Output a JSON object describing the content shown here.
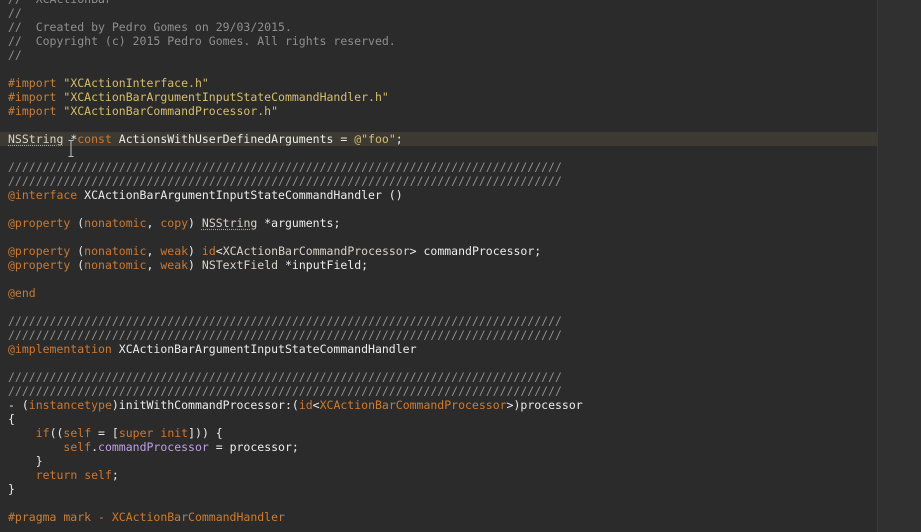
{
  "editor": {
    "language": "objective-c",
    "lines": [
      {
        "tokens": [
          {
            "t": "//  XCActionBar",
            "c": "comment"
          }
        ]
      },
      {
        "tokens": [
          {
            "t": "//",
            "c": "comment"
          }
        ]
      },
      {
        "tokens": [
          {
            "t": "//  Created by Pedro Gomes on 29/03/2015.",
            "c": "comment"
          }
        ]
      },
      {
        "tokens": [
          {
            "t": "//  Copyright (c) 2015 Pedro Gomes. All rights reserved.",
            "c": "comment"
          }
        ]
      },
      {
        "tokens": [
          {
            "t": "//",
            "c": "comment"
          }
        ]
      },
      {
        "tokens": []
      },
      {
        "tokens": [
          {
            "t": "#import ",
            "c": "preproc"
          },
          {
            "t": "\"XCActionInterface.h\"",
            "c": "string"
          }
        ]
      },
      {
        "tokens": [
          {
            "t": "#import ",
            "c": "preproc"
          },
          {
            "t": "\"XCActionBarArgumentInputStateCommandHandler.h\"",
            "c": "string"
          }
        ]
      },
      {
        "tokens": [
          {
            "t": "#import ",
            "c": "preproc"
          },
          {
            "t": "\"XCActionBarCommandProcessor.h\"",
            "c": "string"
          }
        ]
      },
      {
        "tokens": []
      },
      {
        "current": true,
        "tokens": [
          {
            "t": "NSString",
            "c": "class",
            "u": true
          },
          {
            "t": " *",
            "c": "plain"
          },
          {
            "t": "const",
            "c": "keyword"
          },
          {
            "t": " ActionsWithUserDefinedArguments = ",
            "c": "plain"
          },
          {
            "t": "@\"foo\"",
            "c": "string"
          },
          {
            "t": ";",
            "c": "plain"
          }
        ]
      },
      {
        "tokens": []
      },
      {
        "tokens": [
          {
            "t": "////////////////////////////////////////////////////////////////////////////////",
            "c": "comment"
          }
        ]
      },
      {
        "tokens": [
          {
            "t": "////////////////////////////////////////////////////////////////////////////////",
            "c": "comment"
          }
        ]
      },
      {
        "tokens": [
          {
            "t": "@interface",
            "c": "keyword"
          },
          {
            "t": " XCActionBarArgumentInputStateCommandHandler ()",
            "c": "plain"
          }
        ]
      },
      {
        "tokens": []
      },
      {
        "tokens": [
          {
            "t": "@property",
            "c": "keyword"
          },
          {
            "t": " (",
            "c": "plain"
          },
          {
            "t": "nonatomic",
            "c": "keyword"
          },
          {
            "t": ", ",
            "c": "plain"
          },
          {
            "t": "copy",
            "c": "keyword"
          },
          {
            "t": ") ",
            "c": "plain"
          },
          {
            "t": "NSString",
            "c": "class",
            "u": true
          },
          {
            "t": " *arguments;",
            "c": "plain"
          }
        ]
      },
      {
        "tokens": []
      },
      {
        "tokens": [
          {
            "t": "@property",
            "c": "keyword"
          },
          {
            "t": " (",
            "c": "plain"
          },
          {
            "t": "nonatomic",
            "c": "keyword"
          },
          {
            "t": ", ",
            "c": "plain"
          },
          {
            "t": "weak",
            "c": "keyword"
          },
          {
            "t": ") ",
            "c": "plain"
          },
          {
            "t": "id",
            "c": "keyword"
          },
          {
            "t": "<",
            "c": "plain"
          },
          {
            "t": "XCActionBarCommandProcessor",
            "c": "class"
          },
          {
            "t": "> commandProcessor;",
            "c": "plain"
          }
        ]
      },
      {
        "tokens": [
          {
            "t": "@property",
            "c": "keyword"
          },
          {
            "t": " (",
            "c": "plain"
          },
          {
            "t": "nonatomic",
            "c": "keyword"
          },
          {
            "t": ", ",
            "c": "plain"
          },
          {
            "t": "weak",
            "c": "keyword"
          },
          {
            "t": ") ",
            "c": "plain"
          },
          {
            "t": "NSTextField",
            "c": "class"
          },
          {
            "t": " *inputField;",
            "c": "plain"
          }
        ]
      },
      {
        "tokens": []
      },
      {
        "tokens": [
          {
            "t": "@end",
            "c": "keyword"
          }
        ]
      },
      {
        "tokens": []
      },
      {
        "tokens": [
          {
            "t": "////////////////////////////////////////////////////////////////////////////////",
            "c": "comment"
          }
        ]
      },
      {
        "tokens": [
          {
            "t": "////////////////////////////////////////////////////////////////////////////////",
            "c": "comment"
          }
        ]
      },
      {
        "tokens": [
          {
            "t": "@implementation",
            "c": "keyword"
          },
          {
            "t": " XCActionBarArgumentInputStateCommandHandler",
            "c": "plain"
          }
        ]
      },
      {
        "tokens": []
      },
      {
        "tokens": [
          {
            "t": "////////////////////////////////////////////////////////////////////////////////",
            "c": "comment"
          }
        ]
      },
      {
        "tokens": [
          {
            "t": "////////////////////////////////////////////////////////////////////////////////",
            "c": "comment"
          }
        ]
      },
      {
        "tokens": [
          {
            "t": "- (",
            "c": "plain"
          },
          {
            "t": "instancetype",
            "c": "keyword"
          },
          {
            "t": ")initWithCommandProcessor:(",
            "c": "plain"
          },
          {
            "t": "id",
            "c": "keyword"
          },
          {
            "t": "<",
            "c": "plain"
          },
          {
            "t": "XCActionBarCommandProcessor",
            "c": "param"
          },
          {
            "t": ">)processor",
            "c": "plain"
          }
        ]
      },
      {
        "tokens": [
          {
            "t": "{",
            "c": "plain"
          }
        ]
      },
      {
        "tokens": [
          {
            "t": "    ",
            "c": "plain"
          },
          {
            "t": "if",
            "c": "keyword"
          },
          {
            "t": "((",
            "c": "plain"
          },
          {
            "t": "self",
            "c": "keyword"
          },
          {
            "t": " = [",
            "c": "plain"
          },
          {
            "t": "super",
            "c": "keyword"
          },
          {
            "t": " ",
            "c": "plain"
          },
          {
            "t": "init",
            "c": "keyword"
          },
          {
            "t": "])) {",
            "c": "plain"
          }
        ]
      },
      {
        "tokens": [
          {
            "t": "        ",
            "c": "plain"
          },
          {
            "t": "self",
            "c": "keyword"
          },
          {
            "t": ".",
            "c": "plain"
          },
          {
            "t": "commandProcessor",
            "c": "property"
          },
          {
            "t": " = processor;",
            "c": "plain"
          }
        ]
      },
      {
        "tokens": [
          {
            "t": "    }",
            "c": "plain"
          }
        ]
      },
      {
        "tokens": [
          {
            "t": "    ",
            "c": "plain"
          },
          {
            "t": "return",
            "c": "keyword"
          },
          {
            "t": " ",
            "c": "plain"
          },
          {
            "t": "self",
            "c": "keyword"
          },
          {
            "t": ";",
            "c": "plain"
          }
        ]
      },
      {
        "tokens": [
          {
            "t": "}",
            "c": "plain"
          }
        ]
      },
      {
        "tokens": []
      },
      {
        "tokens": [
          {
            "t": "#pragma mark - ",
            "c": "preproc"
          },
          {
            "t": "XCActionBarCommandHandler",
            "c": "param"
          }
        ]
      }
    ]
  }
}
